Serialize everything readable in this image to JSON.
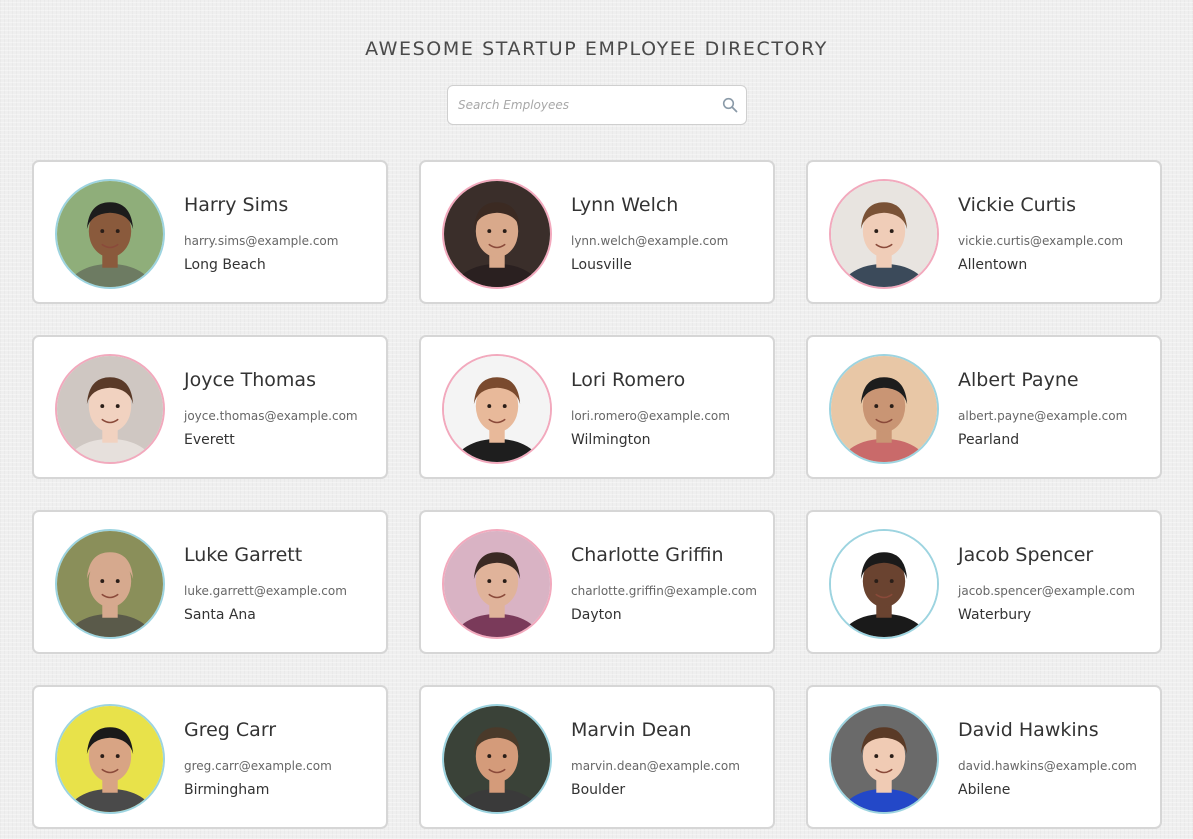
{
  "header": {
    "title": "AWESOME STARTUP EMPLOYEE DIRECTORY"
  },
  "search": {
    "placeholder": "Search Employees",
    "value": "",
    "icon": "search-icon"
  },
  "employees": [
    {
      "name": "Harry Sims",
      "email": "harry.sims@example.com",
      "city": "Long Beach",
      "ring": "blue",
      "bg": "#8fae7a",
      "skin": "#8a5a3c",
      "hair": "#1c1c1c",
      "shirt": "#6d7b62"
    },
    {
      "name": "Lynn Welch",
      "email": "lynn.welch@example.com",
      "city": "Lousville",
      "ring": "pink",
      "bg": "#3a2e2a",
      "skin": "#d9a98b",
      "hair": "#3b2a22",
      "shirt": "#2a2020"
    },
    {
      "name": "Vickie Curtis",
      "email": "vickie.curtis@example.com",
      "city": "Allentown",
      "ring": "pink",
      "bg": "#e8e4e0",
      "skin": "#f0cdb8",
      "hair": "#7a5236",
      "shirt": "#3b4a5a"
    },
    {
      "name": "Joyce Thomas",
      "email": "joyce.thomas@example.com",
      "city": "Everett",
      "ring": "pink",
      "bg": "#cfc7c2",
      "skin": "#f1d2c0",
      "hair": "#5a3a28",
      "shirt": "#e6e0dc"
    },
    {
      "name": "Lori Romero",
      "email": "lori.romero@example.com",
      "city": "Wilmington",
      "ring": "pink",
      "bg": "#f4f4f4",
      "skin": "#e8b99a",
      "hair": "#7a4a2e",
      "shirt": "#1e1e1e"
    },
    {
      "name": "Albert Payne",
      "email": "albert.payne@example.com",
      "city": "Pearland",
      "ring": "blue",
      "bg": "#e8c7a6",
      "skin": "#c99574",
      "hair": "#1d1d1d",
      "shirt": "#c96a6a"
    },
    {
      "name": "Luke Garrett",
      "email": "luke.garrett@example.com",
      "city": "Santa Ana",
      "ring": "blue",
      "bg": "#8a8f5a",
      "skin": "#d6a98e",
      "hair": "#d6a98e",
      "shirt": "#5a5a4a"
    },
    {
      "name": "Charlotte Griffin",
      "email": "charlotte.griffin@example.com",
      "city": "Dayton",
      "ring": "pink",
      "bg": "#d9b3c4",
      "skin": "#e0b39a",
      "hair": "#3a2a24",
      "shirt": "#7a3a5a"
    },
    {
      "name": "Jacob Spencer",
      "email": "jacob.spencer@example.com",
      "city": "Waterbury",
      "ring": "blue",
      "bg": "#ffffff",
      "skin": "#6a4330",
      "hair": "#1a1a1a",
      "shirt": "#1a1a1a"
    },
    {
      "name": "Greg Carr",
      "email": "greg.carr@example.com",
      "city": "Birmingham",
      "ring": "blue",
      "bg": "#e8e24a",
      "skin": "#d8a484",
      "hair": "#1a1a1a",
      "shirt": "#4a4a4a"
    },
    {
      "name": "Marvin Dean",
      "email": "marvin.dean@example.com",
      "city": "Boulder",
      "ring": "blue",
      "bg": "#3a4238",
      "skin": "#d49b7a",
      "hair": "#4a3a2a",
      "shirt": "#3a3a3a"
    },
    {
      "name": "David Hawkins",
      "email": "david.hawkins@example.com",
      "city": "Abilene",
      "ring": "blue",
      "bg": "#6a6a6a",
      "skin": "#f0cbb4",
      "hair": "#5a3a26",
      "shirt": "#2348c8"
    }
  ]
}
